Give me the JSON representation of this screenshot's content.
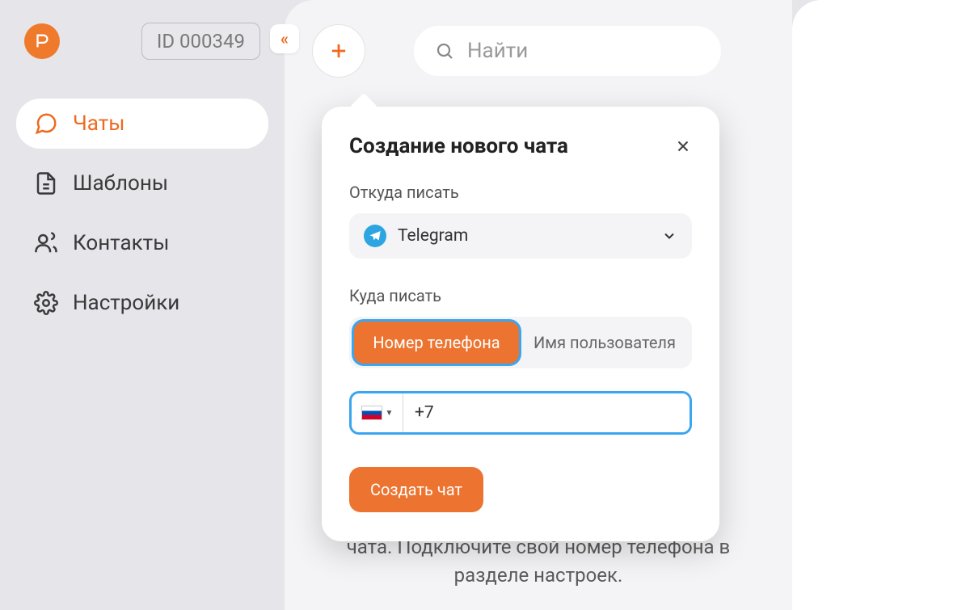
{
  "colors": {
    "accent": "#ee6a1f",
    "highlight": "#3aa6ef",
    "telegram": "#2da5e1"
  },
  "sidebar": {
    "id_label": "ID 000349",
    "items": [
      {
        "key": "chats",
        "label": "Чаты",
        "active": true
      },
      {
        "key": "templates",
        "label": "Шаблоны",
        "active": false
      },
      {
        "key": "contacts",
        "label": "Контакты",
        "active": false
      },
      {
        "key": "settings",
        "label": "Настройки",
        "active": false
      }
    ]
  },
  "search": {
    "placeholder": "Найти"
  },
  "empty_state": {
    "text": "чата. Подключите свой номер телефона в разделе настроек."
  },
  "popover": {
    "title": "Создание нового чата",
    "from_label": "Откуда писать",
    "from_value": "Telegram",
    "to_label": "Куда писать",
    "tabs": {
      "phone": "Номер телефона",
      "username": "Имя пользователя",
      "active": "phone"
    },
    "phone": {
      "country": "RU",
      "value": "+7"
    },
    "submit": "Создать чат"
  }
}
